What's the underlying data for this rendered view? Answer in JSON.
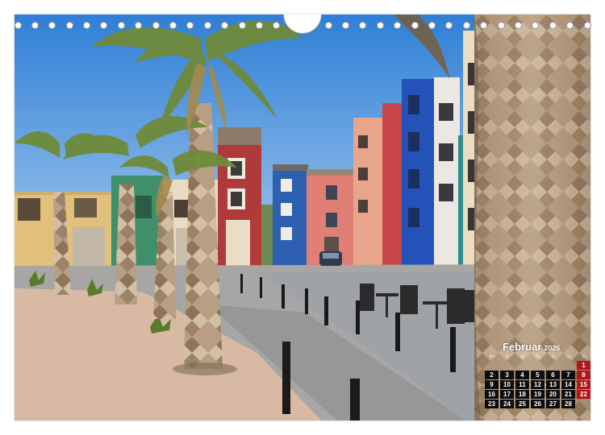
{
  "calendar": {
    "month": "Februar",
    "year": "2026",
    "weekdays": [
      "Mo",
      "Di",
      "Mi",
      "Do",
      "Fr",
      "Sa",
      "So"
    ],
    "weeks": [
      [
        "",
        "",
        "",
        "",
        "",
        "",
        "1"
      ],
      [
        "2",
        "3",
        "4",
        "5",
        "6",
        "7",
        "8"
      ],
      [
        "9",
        "10",
        "11",
        "12",
        "13",
        "14",
        "15"
      ],
      [
        "16",
        "17",
        "18",
        "19",
        "20",
        "21",
        "22"
      ],
      [
        "23",
        "24",
        "25",
        "26",
        "27",
        "28",
        ""
      ]
    ],
    "colors": {
      "day_box": "#0d0d0d",
      "sunday_box": "#b3141a",
      "text": "#ffffff"
    }
  },
  "binding": {
    "hole_count": 34,
    "hook": "hanger-hook"
  }
}
